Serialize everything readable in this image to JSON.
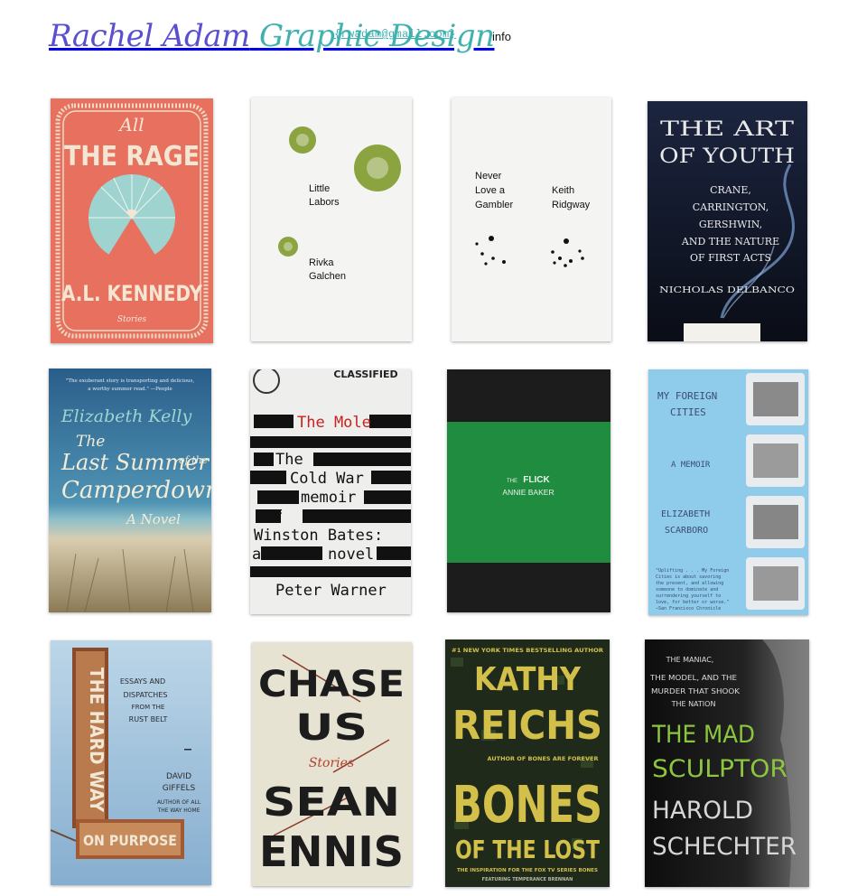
{
  "header": {
    "logo_name": "Rachel Adam",
    "logo_tagline": "Graphic Design",
    "email": "{rwadam@gmail.com}",
    "info_link": "info"
  },
  "books": [
    {
      "title_top": "All",
      "title_main": "THE RAGE",
      "author": "A.L. KENNEDY",
      "subtitle": "Stories"
    },
    {
      "title_line1": "Little",
      "title_line2": "Labors",
      "author_line1": "Rivka",
      "author_line2": "Galchen"
    },
    {
      "title_line1": "Never",
      "title_line2": "Love a",
      "title_line3": "Gambler",
      "author_line1": "Keith",
      "author_line2": "Ridgway"
    },
    {
      "title_line1": "THE ART",
      "title_line2": "OF YOUTH",
      "sub1": "CRANE,",
      "sub2": "CARRINGTON,",
      "sub3": "GERSHWIN,",
      "sub4": "AND THE NATURE",
      "sub5": "OF FIRST ACTS",
      "author": "NICHOLAS DELBANCO"
    },
    {
      "blurb1": "\"The exuberant story is transporting and delicious,",
      "blurb2": "a worthy summer read.\" —People",
      "author": "Elizabeth Kelly",
      "title1": "The",
      "title2": "Last Summer",
      "title3": "of the",
      "title4": "Camperdowns",
      "subtitle": "A Novel"
    },
    {
      "stamp": "CLASSIFIED",
      "line1": "The Mole",
      "line2": "The",
      "line3": "Cold War",
      "line4": "memoir",
      "line5": "of",
      "line6": "Winston Bates:",
      "line7": "a",
      "line8": "novel",
      "author": "Peter Warner"
    },
    {
      "title_prefix": "THE",
      "title": "FLICK",
      "author": "ANNIE BAKER"
    },
    {
      "title1": "MY FOREIGN",
      "title2": "CITIES",
      "subtitle": "A MEMOIR",
      "author1": "ELIZABETH",
      "author2": "SCARBORO",
      "blurb1": "\"Uplifting . . . My Foreign",
      "blurb2": "Cities is about savoring",
      "blurb3": "the present, and allowing",
      "blurb4": "someone to dominate and",
      "blurb5": "surrendering yourself to",
      "blurb6": "love, for better or worse.\"",
      "blurb7": "—San Francisco Chronicle"
    },
    {
      "sign": "THE HARD WAY",
      "sign_base": "ON PURPOSE",
      "sub1": "ESSAYS AND",
      "sub2": "DISPATCHES",
      "sub3": "FROM THE",
      "sub4": "RUST BELT",
      "author1": "DAVID",
      "author2": "GIFFELS",
      "credit1": "AUTHOR OF ALL",
      "credit2": "THE WAY HOME"
    },
    {
      "title1": "CHASE",
      "title2": "US",
      "subtitle": "Stories",
      "author1": "SEAN",
      "author2": "ENNIS"
    },
    {
      "banner": "#1 NEW YORK TIMES BESTSELLING AUTHOR",
      "author1": "KATHY",
      "author2": "REICHS",
      "credit": "AUTHOR OF BONES ARE FOREVER",
      "title1": "BONES",
      "title2": "OF THE LOST",
      "footer1": "THE INSPIRATION FOR THE FOX TV SERIES BONES",
      "footer2": "FEATURING TEMPERANCE BRENNAN"
    },
    {
      "tag1": "THE MANIAC,",
      "tag2": "THE MODEL, AND THE",
      "tag3": "MURDER THAT SHOOK",
      "tag4": "THE NATION",
      "title1": "THE MAD",
      "title2": "SCULPTOR",
      "author1": "HAROLD",
      "author2": "SCHECHTER"
    }
  ],
  "colors": {
    "accent_purple": "#5a4fd0",
    "accent_teal": "#3fb2b0",
    "flick_green": "#1f8c3f",
    "youth_navy": "#111a2e"
  }
}
